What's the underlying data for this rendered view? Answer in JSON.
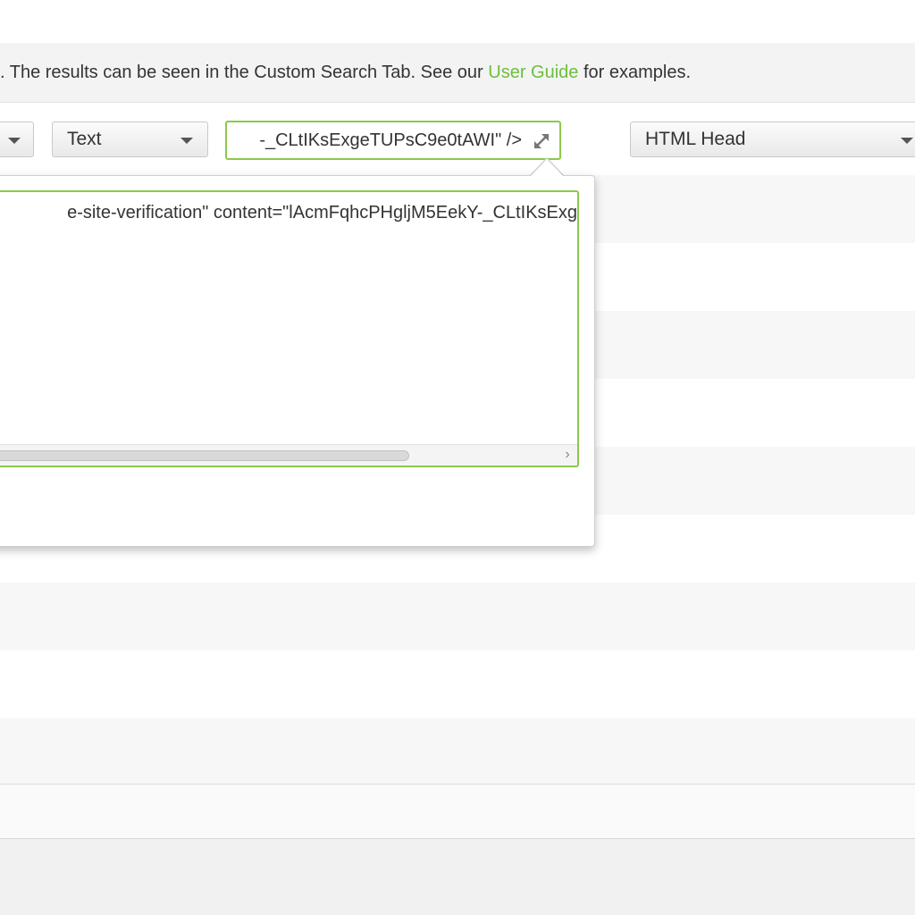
{
  "info_bar": {
    "text_before": ". The results can be seen in the Custom Search Tab. See our ",
    "link": "User Guide",
    "text_after": " for examples.",
    "link_color": "#6cbf3c"
  },
  "controls": {
    "left_select": {
      "value": ""
    },
    "type_select": {
      "value": "Text"
    },
    "search_input": {
      "value": "-_CLtIKsExgeTUPsC9e0tAWI\" />"
    },
    "scope_select": {
      "value": "HTML Head"
    }
  },
  "expanded_editor": {
    "text": "e-site-verification\" content=\"lAcmFqhcPHgljM5EekY-_CLtIKsExg"
  },
  "icons": {
    "expand": "expand-arrows-icon",
    "scroll_right": "chevron-right-icon",
    "dropdown": "caret-down-icon"
  },
  "colors": {
    "accent_green": "#8cc84b",
    "info_bar_bg": "#f3f3f3",
    "row_alt_bg": "#f7f7f7"
  }
}
